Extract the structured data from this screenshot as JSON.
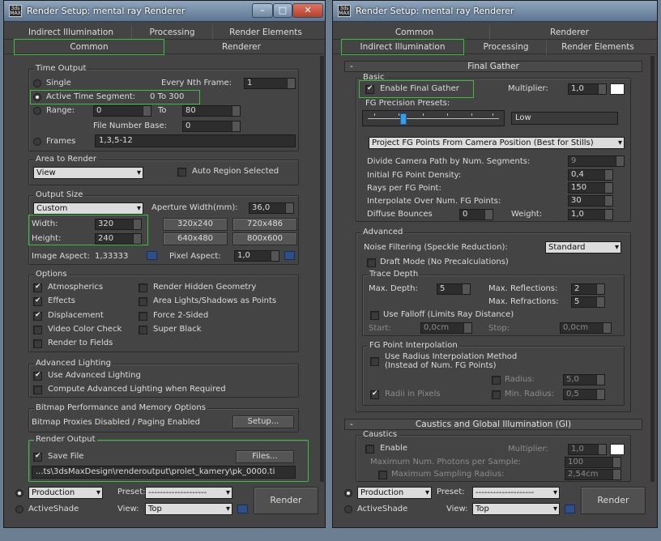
{
  "left": {
    "title": "Render Setup: mental ray Renderer",
    "tabs_top": [
      "Indirect Illumination",
      "Processing",
      "Render Elements"
    ],
    "tabs_bottom": [
      "Common",
      "Renderer"
    ],
    "time_output": {
      "title": "Time Output",
      "single": "Single",
      "every_nth": "Every Nth Frame:",
      "every_nth_value": "1",
      "active_segment": "Active Time Segment:",
      "active_segment_value": "0 To 300",
      "range": "Range:",
      "range_from": "0",
      "range_to_label": "To",
      "range_to": "80",
      "file_number_base": "File Number Base:",
      "file_number_base_value": "0",
      "frames": "Frames",
      "frames_value": "1,3,5-12"
    },
    "area": {
      "title": "Area to Render",
      "dropdown": "View",
      "auto_region": "Auto Region Selected"
    },
    "output_size": {
      "title": "Output Size",
      "preset": "Custom",
      "aperture_label": "Aperture Width(mm):",
      "aperture_value": "36,0",
      "width_label": "Width:",
      "width_value": "320",
      "height_label": "Height:",
      "height_value": "240",
      "presets": [
        "320x240",
        "720x486",
        "640x480",
        "800x600"
      ],
      "image_aspect_label": "Image Aspect:",
      "image_aspect_value": "1,33333",
      "pixel_aspect_label": "Pixel Aspect:",
      "pixel_aspect_value": "1,0"
    },
    "options": {
      "title": "Options",
      "items": [
        "Atmospherics",
        "Render Hidden Geometry",
        "Effects",
        "Area Lights/Shadows as Points",
        "Displacement",
        "Force 2-Sided",
        "Video Color Check",
        "Super Black",
        "Render to Fields"
      ]
    },
    "advanced_lighting": {
      "title": "Advanced Lighting",
      "use": "Use Advanced Lighting",
      "compute": "Compute Advanced Lighting when Required"
    },
    "bitmap": {
      "title": "Bitmap Performance and Memory Options",
      "status": "Bitmap Proxies Disabled / Paging Enabled",
      "setup": "Setup..."
    },
    "render_output": {
      "title": "Render Output",
      "save_file": "Save File",
      "files_button": "Files...",
      "path": "...ts\\3dsMaxDesign\\renderoutput\\prolet_kamery\\pk_0000.ti"
    },
    "bottom": {
      "production": "Production",
      "activeshade": "ActiveShade",
      "preset_label": "Preset:",
      "preset_value": "--------------------",
      "view_label": "View:",
      "view_value": "Top",
      "render": "Render"
    }
  },
  "right": {
    "title": "Render Setup: mental ray Renderer",
    "tabs_top": [
      "Common",
      "Renderer"
    ],
    "tabs_bottom": [
      "Indirect Illumination",
      "Processing",
      "Render Elements"
    ],
    "final_gather": {
      "title": "Final Gather",
      "collapse": "-",
      "basic": "Basic",
      "enable": "Enable Final Gather",
      "multiplier_label": "Multiplier:",
      "multiplier_value": "1,0",
      "presets_label": "FG Precision Presets:",
      "preset_value": "Low",
      "project_dropdown": "Project FG Points From Camera Position (Best for Stills)",
      "divide_label": "Divide Camera Path by Num. Segments:",
      "divide_value": "9",
      "density_label": "Initial FG Point Density:",
      "density_value": "0,4",
      "rays_label": "Rays per FG Point:",
      "rays_value": "150",
      "interp_label": "Interpolate Over Num. FG Points:",
      "interp_value": "30",
      "bounces_label": "Diffuse Bounces",
      "bounces_value": "0",
      "weight_label": "Weight:",
      "weight_value": "1,0"
    },
    "advanced": {
      "title": "Advanced",
      "noise_label": "Noise Filtering (Speckle Reduction):",
      "noise_value": "Standard",
      "draft": "Draft Mode (No Precalculations)",
      "trace_depth": "Trace Depth",
      "max_depth_label": "Max. Depth:",
      "max_depth_value": "5",
      "max_refl_label": "Max. Reflections:",
      "max_refl_value": "2",
      "max_refr_label": "Max. Refractions:",
      "max_refr_value": "5",
      "use_falloff": "Use Falloff (Limits Ray Distance)",
      "start_label": "Start:",
      "start_value": "0,0cm",
      "stop_label": "Stop:",
      "stop_value": "0,0cm"
    },
    "fg_interp": {
      "title": "FG Point Interpolation",
      "radius_method_1": "Use Radius Interpolation Method",
      "radius_method_2": "(Instead of Num. FG Points)",
      "radius_label": "Radius:",
      "radius_value": "5,0",
      "radii_pixels": "Radii in Pixels",
      "min_radius_label": "Min. Radius:",
      "min_radius_value": "0,5"
    },
    "caustics_gi": {
      "title": "Caustics and Global Illumination (GI)",
      "collapse": "-",
      "caustics": "Caustics",
      "enable": "Enable",
      "multiplier_label": "Multiplier:",
      "multiplier_value": "1,0",
      "photons_label": "Maximum Num. Photons per Sample:",
      "photons_value": "100",
      "max_sampling_label": "Maximum Sampling Radius:",
      "max_sampling_value": "2,54cm"
    },
    "bottom": {
      "production": "Production",
      "activeshade": "ActiveShade",
      "preset_label": "Preset:",
      "preset_value": "--------------------",
      "view_label": "View:",
      "view_value": "Top",
      "render": "Render"
    }
  }
}
